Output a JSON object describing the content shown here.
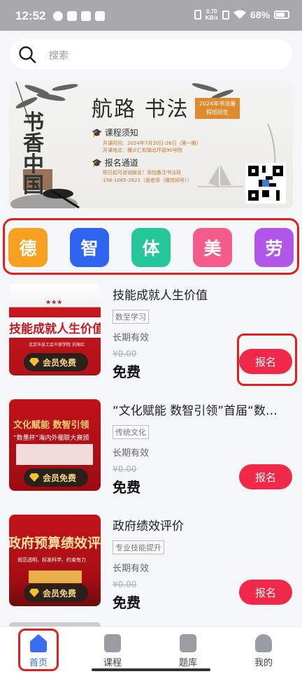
{
  "status": {
    "time": "12:52",
    "speed_value": "0.70",
    "speed_unit": "KB/s",
    "battery": "68%"
  },
  "search": {
    "placeholder": "搜索",
    "icon": "search-icon"
  },
  "banner": {
    "title": "航路 书法",
    "tag": "2024年书法暑假班招生",
    "side_text": "书香中国",
    "notice_heading": "课程须知",
    "notice_line1": "开课时间：2024年7月20日-26日（第一期）",
    "notice_line2": "开课地点：播义仁和镇北环路90号院",
    "signup_heading": "报名通道",
    "signup_line1": "即日起可咨询报名！添加备注书法班",
    "signup_line2": "158-1085-2621（张老师（微信同号））"
  },
  "categories": [
    {
      "label": "德",
      "color": "#f7a020"
    },
    {
      "label": "智",
      "color": "#2f64f0"
    },
    {
      "label": "体",
      "color": "#25c69a"
    },
    {
      "label": "美",
      "color": "#f45c8c"
    },
    {
      "label": "劳",
      "color": "#b056ea"
    }
  ],
  "courses": [
    {
      "title": "技能成就人生价值",
      "tag": "数至学习",
      "validity": "长期有效",
      "original_price": "¥0.00",
      "price": "免费",
      "enroll": "报名",
      "member": "会员免费",
      "thumb_text": "技能成就人生价值",
      "thumb_sub": "北京市总工会干部学院  刘海红"
    },
    {
      "title": "“文化赋能 数智引领”首届“数…",
      "tag": "传统文化",
      "validity": "长期有效",
      "original_price": "¥0.00",
      "price": "免费",
      "enroll": "报名",
      "member": "会员免费",
      "thumb_text": "文化赋能 数智引领",
      "thumb_sub": "“数墨杯”海内外楹联大赛颁"
    },
    {
      "title": "政府绩效评价",
      "tag": "专业技能提升",
      "validity": "长期有效",
      "original_price": "¥0.00",
      "price": "免费",
      "enroll": "报名",
      "member": "会员免费",
      "thumb_text": "政府预算绩效评价",
      "thumb_sub": "规范透明、标准科学、约束有力"
    }
  ],
  "tabs": [
    {
      "label": "首页",
      "icon": "home-icon"
    },
    {
      "label": "课程",
      "icon": "book-icon"
    },
    {
      "label": "题库",
      "icon": "question-bank-icon"
    },
    {
      "label": "我的",
      "icon": "profile-icon"
    }
  ]
}
